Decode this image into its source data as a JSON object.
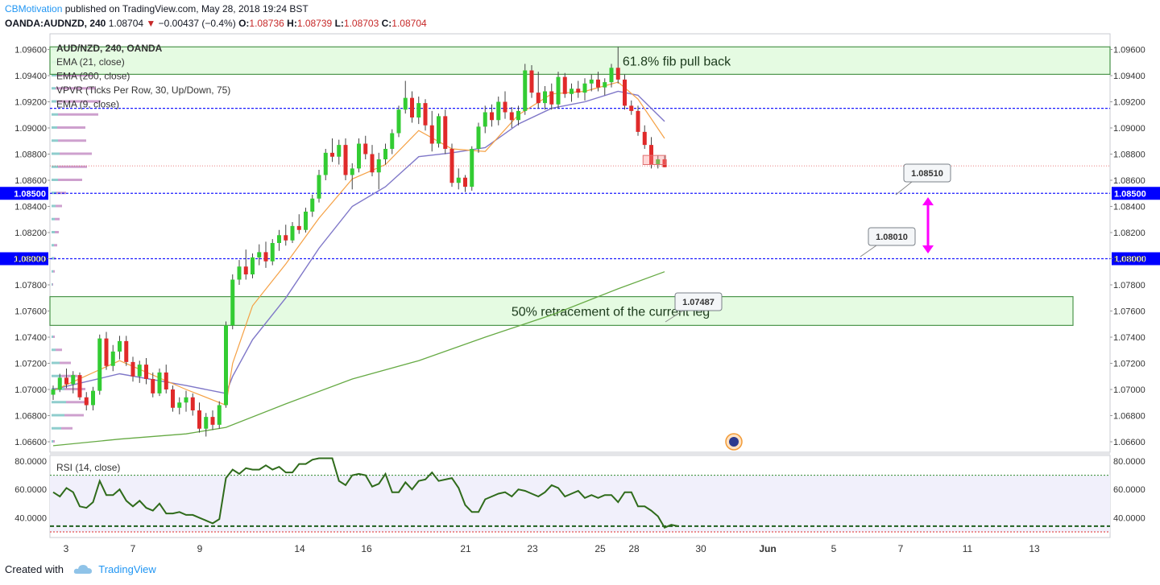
{
  "header": {
    "publisher": "CBMotivation",
    "published_text": "published on TradingView.com, May 28, 2018 19:24 BST",
    "symbol": "OANDA:AUDNZD, 240",
    "last": "1.08704",
    "change": "−0.00437 (−0.4%)",
    "ohlc": {
      "o": "1.08736",
      "h": "1.08739",
      "l": "1.08703",
      "c": "1.08704"
    }
  },
  "footer": {
    "created_with": "Created with",
    "brand": "TradingView"
  },
  "colors": {
    "up": "#33cc33",
    "down": "#e02a2a",
    "ema9": "#f5a145",
    "ema21": "#7f77c8",
    "ema200": "#66aa44",
    "zone_fill": "#e3fbdf",
    "zone_border": "#3a8a3a",
    "level_line": "#1a1aff",
    "label_bg": "#0000ff",
    "rsi": "#2f6b1b",
    "arrow": "#ff00ff"
  },
  "chart_data": {
    "type": "candlestick",
    "title": "AUD/NZD, 240, OANDA",
    "indicators": [
      "EMA (21, close)",
      "EMA (200, close)",
      "VPVR (Ticks Per Row, 30, Up/Down, 75)",
      "EMA (9, close)"
    ],
    "ylim": [
      1.0652,
      1.0972
    ],
    "y_ticks": [
      "1.06600",
      "1.06800",
      "1.07000",
      "1.07200",
      "1.07400",
      "1.07600",
      "1.07800",
      "1.08000",
      "1.08200",
      "1.08400",
      "1.08600",
      "1.08800",
      "1.09000",
      "1.09200",
      "1.09400",
      "1.09600"
    ],
    "x_ticks": [
      "3",
      "7",
      "9",
      "14",
      "16",
      "21",
      "23",
      "25",
      "28",
      "30",
      "Jun",
      "5",
      "7",
      "11",
      "13"
    ],
    "candles": [
      [
        1.0696,
        1.0703,
        1.0692,
        1.07
      ],
      [
        1.07,
        1.0712,
        1.0698,
        1.0709
      ],
      [
        1.0709,
        1.0716,
        1.0701,
        1.0704
      ],
      [
        1.0704,
        1.0714,
        1.0697,
        1.0711
      ],
      [
        1.0711,
        1.0713,
        1.0692,
        1.0694
      ],
      [
        1.0694,
        1.0698,
        1.0684,
        1.0688
      ],
      [
        1.0688,
        1.0702,
        1.0684,
        1.0699
      ],
      [
        1.0699,
        1.0742,
        1.0696,
        1.0739
      ],
      [
        1.0739,
        1.0744,
        1.0715,
        1.0718
      ],
      [
        1.0718,
        1.0734,
        1.0714,
        1.0729
      ],
      [
        1.0729,
        1.0741,
        1.0723,
        1.0737
      ],
      [
        1.0737,
        1.0741,
        1.0718,
        1.0721
      ],
      [
        1.0721,
        1.0725,
        1.0706,
        1.071
      ],
      [
        1.071,
        1.0722,
        1.0705,
        1.0719
      ],
      [
        1.0719,
        1.0724,
        1.0704,
        1.0708
      ],
      [
        1.0708,
        1.0713,
        1.0694,
        1.0697
      ],
      [
        1.0697,
        1.0716,
        1.0695,
        1.0713
      ],
      [
        1.0713,
        1.0719,
        1.0697,
        1.07
      ],
      [
        1.07,
        1.0703,
        1.0683,
        1.0686
      ],
      [
        1.0686,
        1.0694,
        1.0681,
        1.069
      ],
      [
        1.069,
        1.0699,
        1.0683,
        1.0694
      ],
      [
        1.0694,
        1.0697,
        1.068,
        1.0684
      ],
      [
        1.0684,
        1.069,
        1.0667,
        1.067
      ],
      [
        1.067,
        1.0682,
        1.0664,
        1.0679
      ],
      [
        1.0679,
        1.0684,
        1.0669,
        1.0673
      ],
      [
        1.0673,
        1.0691,
        1.067,
        1.0688
      ],
      [
        1.0688,
        1.0752,
        1.0686,
        1.0749
      ],
      [
        1.0749,
        1.0788,
        1.0746,
        1.0784
      ],
      [
        1.0784,
        1.0799,
        1.078,
        1.0794
      ],
      [
        1.0794,
        1.0807,
        1.0784,
        1.0788
      ],
      [
        1.0788,
        1.0804,
        1.0785,
        1.0801
      ],
      [
        1.0801,
        1.0811,
        1.0795,
        1.0805
      ],
      [
        1.0805,
        1.0813,
        1.0793,
        1.0798
      ],
      [
        1.0798,
        1.0815,
        1.0795,
        1.0812
      ],
      [
        1.0812,
        1.0822,
        1.0806,
        1.0818
      ],
      [
        1.0818,
        1.0826,
        1.081,
        1.0814
      ],
      [
        1.0814,
        1.0828,
        1.0812,
        1.0825
      ],
      [
        1.0825,
        1.0834,
        1.0819,
        1.0822
      ],
      [
        1.0822,
        1.0839,
        1.082,
        1.0836
      ],
      [
        1.0836,
        1.0849,
        1.0832,
        1.0846
      ],
      [
        1.0846,
        1.0868,
        1.0843,
        1.0864
      ],
      [
        1.0864,
        1.0884,
        1.086,
        1.0881
      ],
      [
        1.0881,
        1.0892,
        1.0874,
        1.0878
      ],
      [
        1.0878,
        1.0891,
        1.0872,
        1.0887
      ],
      [
        1.0887,
        1.0892,
        1.086,
        1.0864
      ],
      [
        1.0864,
        1.0873,
        1.0853,
        1.0869
      ],
      [
        1.0869,
        1.0892,
        1.0866,
        1.0888
      ],
      [
        1.0888,
        1.0894,
        1.0876,
        1.088
      ],
      [
        1.088,
        1.0887,
        1.0863,
        1.0866
      ],
      [
        1.0866,
        1.0881,
        1.0853,
        1.0876
      ],
      [
        1.0876,
        1.0888,
        1.0872,
        1.0884
      ],
      [
        1.0884,
        1.0899,
        1.088,
        1.0896
      ],
      [
        1.0896,
        1.0917,
        1.0893,
        1.0914
      ],
      [
        1.0914,
        1.0936,
        1.0911,
        1.0923
      ],
      [
        1.0923,
        1.0928,
        1.0904,
        1.0908
      ],
      [
        1.0908,
        1.0924,
        1.0903,
        1.0919
      ],
      [
        1.0919,
        1.0922,
        1.0898,
        1.0902
      ],
      [
        1.0902,
        1.0913,
        1.0882,
        1.0888
      ],
      [
        1.0888,
        1.0911,
        1.0885,
        1.0909
      ],
      [
        1.0909,
        1.0914,
        1.088,
        1.0884
      ],
      [
        1.0884,
        1.0888,
        1.0855,
        1.0858
      ],
      [
        1.0858,
        1.0869,
        1.0853,
        1.0862
      ],
      [
        1.0862,
        1.0864,
        1.0851,
        1.0855
      ],
      [
        1.0855,
        1.0886,
        1.0852,
        1.0884
      ],
      [
        1.0884,
        1.0904,
        1.0881,
        1.0901
      ],
      [
        1.0901,
        1.0917,
        1.0896,
        1.0912
      ],
      [
        1.0912,
        1.0918,
        1.0901,
        1.0906
      ],
      [
        1.0906,
        1.0924,
        1.0902,
        1.092
      ],
      [
        1.092,
        1.0928,
        1.0907,
        1.0912
      ],
      [
        1.0912,
        1.0916,
        1.09,
        1.0906
      ],
      [
        1.0906,
        1.0917,
        1.0902,
        1.0913
      ],
      [
        1.0913,
        1.0949,
        1.091,
        1.0944
      ],
      [
        1.0944,
        1.0948,
        1.0923,
        1.0927
      ],
      [
        1.0927,
        1.0943,
        1.0915,
        1.0919
      ],
      [
        1.0919,
        1.0932,
        1.0914,
        1.0928
      ],
      [
        1.0928,
        1.0934,
        1.0914,
        1.0918
      ],
      [
        1.0918,
        1.0943,
        1.0915,
        1.0939
      ],
      [
        1.0939,
        1.0942,
        1.0923,
        1.0926
      ],
      [
        1.0926,
        1.0934,
        1.092,
        1.093
      ],
      [
        1.093,
        1.0936,
        1.0923,
        1.0927
      ],
      [
        1.0927,
        1.0938,
        1.0921,
        1.0934
      ],
      [
        1.0934,
        1.0941,
        1.0928,
        1.0937
      ],
      [
        1.0937,
        1.0943,
        1.0928,
        1.0931
      ],
      [
        1.0931,
        1.0938,
        1.0925,
        1.0935
      ],
      [
        1.0935,
        1.0949,
        1.0931,
        1.0946
      ],
      [
        1.0946,
        1.0962,
        1.0934,
        1.0937
      ],
      [
        1.0937,
        1.0941,
        1.0914,
        1.0917
      ],
      [
        1.0917,
        1.0921,
        1.091,
        1.0913
      ],
      [
        1.0913,
        1.0917,
        1.0894,
        1.0897
      ],
      [
        1.0897,
        1.0902,
        1.0884,
        1.0887
      ],
      [
        1.0887,
        1.0893,
        1.0869,
        1.0872
      ],
      [
        1.0872,
        1.0879,
        1.0869,
        1.0876
      ],
      [
        1.0876,
        1.0879,
        1.087,
        1.087
      ]
    ],
    "last_candle_outline": {
      "from": 1.0872,
      "to": 1.0879
    },
    "ema9": [
      [
        0,
        1.0699
      ],
      [
        10,
        1.0722
      ],
      [
        20,
        1.07
      ],
      [
        26,
        1.0688
      ],
      [
        27,
        1.072
      ],
      [
        30,
        1.0764
      ],
      [
        35,
        1.0796
      ],
      [
        40,
        1.0831
      ],
      [
        45,
        1.0861
      ],
      [
        50,
        1.0872
      ],
      [
        55,
        1.0898
      ],
      [
        60,
        1.0884
      ],
      [
        65,
        1.0882
      ],
      [
        70,
        1.091
      ],
      [
        75,
        1.0926
      ],
      [
        80,
        1.0928
      ],
      [
        85,
        1.0935
      ],
      [
        88,
        1.0922
      ],
      [
        92,
        1.0892
      ]
    ],
    "ema21": [
      [
        0,
        1.07
      ],
      [
        10,
        1.0712
      ],
      [
        20,
        1.0703
      ],
      [
        26,
        1.0697
      ],
      [
        27,
        1.071
      ],
      [
        30,
        1.0738
      ],
      [
        35,
        1.077
      ],
      [
        40,
        1.0808
      ],
      [
        45,
        1.084
      ],
      [
        50,
        1.0855
      ],
      [
        55,
        1.0878
      ],
      [
        60,
        1.0881
      ],
      [
        65,
        1.0885
      ],
      [
        70,
        1.0903
      ],
      [
        75,
        1.0915
      ],
      [
        80,
        1.092
      ],
      [
        85,
        1.0928
      ],
      [
        88,
        1.0925
      ],
      [
        92,
        1.0905
      ]
    ],
    "ema200": [
      [
        0,
        1.0657
      ],
      [
        10,
        1.0662
      ],
      [
        20,
        1.0666
      ],
      [
        26,
        1.0671
      ],
      [
        35,
        1.0689
      ],
      [
        45,
        1.0708
      ],
      [
        55,
        1.0722
      ],
      [
        65,
        1.074
      ],
      [
        75,
        1.0757
      ],
      [
        85,
        1.0777
      ],
      [
        92,
        1.079
      ]
    ],
    "zones": [
      {
        "from": 1.0941,
        "to": 1.0962,
        "label": "61.8% fib pull back"
      },
      {
        "from": 1.0749,
        "to": 1.0771,
        "label": "50% retracement of the current leg"
      }
    ],
    "levels": [
      {
        "value": 1.0915,
        "label": ""
      },
      {
        "value": 1.085,
        "label": "1.08500"
      },
      {
        "value": 1.08,
        "label": "1.08000"
      }
    ],
    "current_price_line": 1.0871,
    "callouts": [
      {
        "text": "1.08510",
        "at": 1.0851
      },
      {
        "text": "1.08010",
        "at": 1.0801
      },
      {
        "text": "1.07487",
        "at": 1.07487
      }
    ],
    "arrow": {
      "from": 1.0804,
      "to": 1.0847
    },
    "vpvr": [
      [
        1.096,
        10,
        1
      ],
      [
        1.095,
        8,
        10
      ],
      [
        1.094,
        6,
        45
      ],
      [
        1.093,
        5,
        50
      ],
      [
        1.092,
        6,
        55
      ],
      [
        1.091,
        8,
        50
      ],
      [
        1.09,
        7,
        35
      ],
      [
        1.089,
        8,
        35
      ],
      [
        1.088,
        10,
        40
      ],
      [
        1.087,
        8,
        36
      ],
      [
        1.086,
        8,
        30
      ],
      [
        1.085,
        6,
        12
      ],
      [
        1.084,
        5,
        8
      ],
      [
        1.083,
        4,
        6
      ],
      [
        1.082,
        4,
        5
      ],
      [
        1.081,
        3,
        4
      ],
      [
        1.08,
        3,
        2
      ],
      [
        1.079,
        2,
        2
      ],
      [
        1.078,
        1,
        1
      ],
      [
        1.074,
        2,
        2
      ],
      [
        1.073,
        5,
        8
      ],
      [
        1.072,
        10,
        14
      ],
      [
        1.071,
        12,
        20
      ],
      [
        1.07,
        16,
        26
      ],
      [
        1.069,
        18,
        28
      ],
      [
        1.068,
        16,
        24
      ],
      [
        1.067,
        12,
        14
      ],
      [
        1.066,
        2,
        2
      ]
    ],
    "rsi": {
      "label": "RSI (14, close)",
      "ylim": [
        26,
        84
      ],
      "ticks": [
        "80.0000",
        "60.0000",
        "40.0000"
      ],
      "bands": [
        70,
        30
      ],
      "support": 34,
      "values": [
        58,
        55,
        61,
        58,
        48,
        47,
        51,
        66,
        56,
        56,
        60,
        52,
        48,
        52,
        47,
        45,
        50,
        43,
        43,
        44,
        42,
        42,
        40,
        38,
        36,
        39,
        68,
        74,
        71,
        75,
        74,
        74,
        77,
        74,
        76,
        72,
        72,
        78,
        78,
        81,
        82,
        82,
        82,
        66,
        63,
        70,
        71,
        70,
        62,
        64,
        71,
        58,
        58,
        65,
        60,
        66,
        67,
        72,
        66,
        67,
        68,
        61,
        49,
        44,
        44,
        53,
        55,
        57,
        58,
        55,
        60,
        59,
        57,
        55,
        58,
        63,
        61,
        55,
        57,
        59,
        54,
        56,
        54,
        56,
        56,
        51,
        58,
        58,
        48,
        48,
        45,
        41,
        33,
        35,
        34
      ]
    }
  }
}
